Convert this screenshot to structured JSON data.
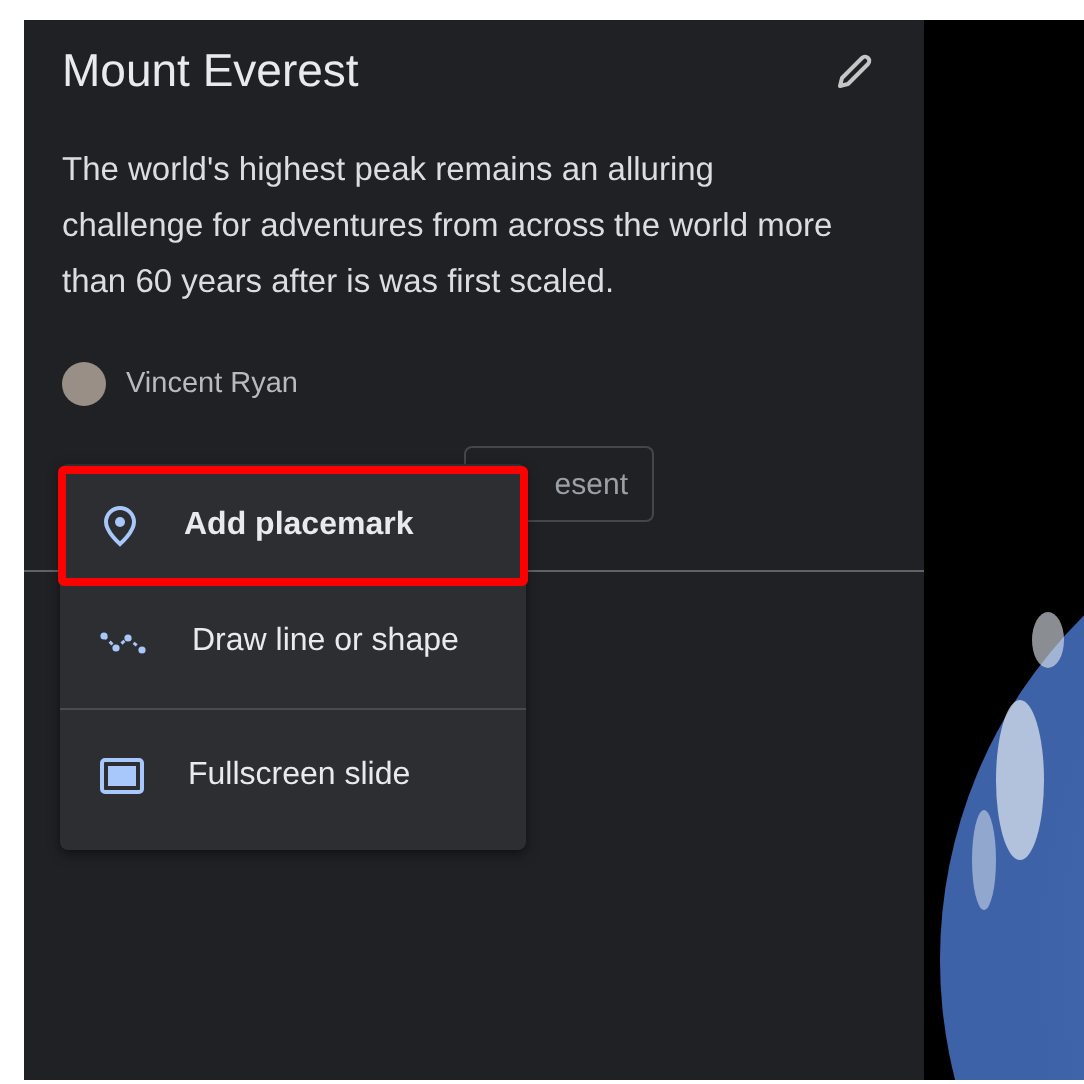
{
  "panel": {
    "title": "Mount Everest",
    "description": "The world's highest peak remains an alluring challenge for adventures from across the world more than 60 years after is was first scaled.",
    "author": "Vincent Ryan",
    "present_button": "esent"
  },
  "menu": {
    "items": [
      {
        "label": "Add placemark",
        "highlighted": true
      },
      {
        "label": "Draw line or shape",
        "highlighted": false
      },
      {
        "label": "Fullscreen slide",
        "highlighted": false
      }
    ]
  }
}
